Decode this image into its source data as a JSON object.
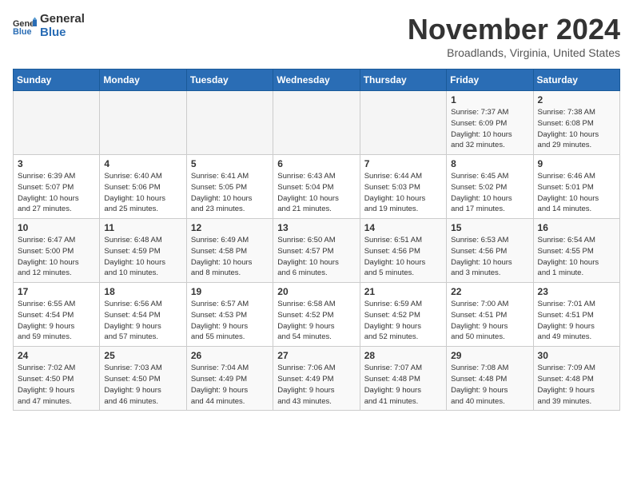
{
  "header": {
    "logo_general": "General",
    "logo_blue": "Blue",
    "month": "November 2024",
    "location": "Broadlands, Virginia, United States"
  },
  "days_of_week": [
    "Sunday",
    "Monday",
    "Tuesday",
    "Wednesday",
    "Thursday",
    "Friday",
    "Saturday"
  ],
  "weeks": [
    [
      {
        "day": "",
        "info": ""
      },
      {
        "day": "",
        "info": ""
      },
      {
        "day": "",
        "info": ""
      },
      {
        "day": "",
        "info": ""
      },
      {
        "day": "",
        "info": ""
      },
      {
        "day": "1",
        "info": "Sunrise: 7:37 AM\nSunset: 6:09 PM\nDaylight: 10 hours\nand 32 minutes."
      },
      {
        "day": "2",
        "info": "Sunrise: 7:38 AM\nSunset: 6:08 PM\nDaylight: 10 hours\nand 29 minutes."
      }
    ],
    [
      {
        "day": "3",
        "info": "Sunrise: 6:39 AM\nSunset: 5:07 PM\nDaylight: 10 hours\nand 27 minutes."
      },
      {
        "day": "4",
        "info": "Sunrise: 6:40 AM\nSunset: 5:06 PM\nDaylight: 10 hours\nand 25 minutes."
      },
      {
        "day": "5",
        "info": "Sunrise: 6:41 AM\nSunset: 5:05 PM\nDaylight: 10 hours\nand 23 minutes."
      },
      {
        "day": "6",
        "info": "Sunrise: 6:43 AM\nSunset: 5:04 PM\nDaylight: 10 hours\nand 21 minutes."
      },
      {
        "day": "7",
        "info": "Sunrise: 6:44 AM\nSunset: 5:03 PM\nDaylight: 10 hours\nand 19 minutes."
      },
      {
        "day": "8",
        "info": "Sunrise: 6:45 AM\nSunset: 5:02 PM\nDaylight: 10 hours\nand 17 minutes."
      },
      {
        "day": "9",
        "info": "Sunrise: 6:46 AM\nSunset: 5:01 PM\nDaylight: 10 hours\nand 14 minutes."
      }
    ],
    [
      {
        "day": "10",
        "info": "Sunrise: 6:47 AM\nSunset: 5:00 PM\nDaylight: 10 hours\nand 12 minutes."
      },
      {
        "day": "11",
        "info": "Sunrise: 6:48 AM\nSunset: 4:59 PM\nDaylight: 10 hours\nand 10 minutes."
      },
      {
        "day": "12",
        "info": "Sunrise: 6:49 AM\nSunset: 4:58 PM\nDaylight: 10 hours\nand 8 minutes."
      },
      {
        "day": "13",
        "info": "Sunrise: 6:50 AM\nSunset: 4:57 PM\nDaylight: 10 hours\nand 6 minutes."
      },
      {
        "day": "14",
        "info": "Sunrise: 6:51 AM\nSunset: 4:56 PM\nDaylight: 10 hours\nand 5 minutes."
      },
      {
        "day": "15",
        "info": "Sunrise: 6:53 AM\nSunset: 4:56 PM\nDaylight: 10 hours\nand 3 minutes."
      },
      {
        "day": "16",
        "info": "Sunrise: 6:54 AM\nSunset: 4:55 PM\nDaylight: 10 hours\nand 1 minute."
      }
    ],
    [
      {
        "day": "17",
        "info": "Sunrise: 6:55 AM\nSunset: 4:54 PM\nDaylight: 9 hours\nand 59 minutes."
      },
      {
        "day": "18",
        "info": "Sunrise: 6:56 AM\nSunset: 4:54 PM\nDaylight: 9 hours\nand 57 minutes."
      },
      {
        "day": "19",
        "info": "Sunrise: 6:57 AM\nSunset: 4:53 PM\nDaylight: 9 hours\nand 55 minutes."
      },
      {
        "day": "20",
        "info": "Sunrise: 6:58 AM\nSunset: 4:52 PM\nDaylight: 9 hours\nand 54 minutes."
      },
      {
        "day": "21",
        "info": "Sunrise: 6:59 AM\nSunset: 4:52 PM\nDaylight: 9 hours\nand 52 minutes."
      },
      {
        "day": "22",
        "info": "Sunrise: 7:00 AM\nSunset: 4:51 PM\nDaylight: 9 hours\nand 50 minutes."
      },
      {
        "day": "23",
        "info": "Sunrise: 7:01 AM\nSunset: 4:51 PM\nDaylight: 9 hours\nand 49 minutes."
      }
    ],
    [
      {
        "day": "24",
        "info": "Sunrise: 7:02 AM\nSunset: 4:50 PM\nDaylight: 9 hours\nand 47 minutes."
      },
      {
        "day": "25",
        "info": "Sunrise: 7:03 AM\nSunset: 4:50 PM\nDaylight: 9 hours\nand 46 minutes."
      },
      {
        "day": "26",
        "info": "Sunrise: 7:04 AM\nSunset: 4:49 PM\nDaylight: 9 hours\nand 44 minutes."
      },
      {
        "day": "27",
        "info": "Sunrise: 7:06 AM\nSunset: 4:49 PM\nDaylight: 9 hours\nand 43 minutes."
      },
      {
        "day": "28",
        "info": "Sunrise: 7:07 AM\nSunset: 4:48 PM\nDaylight: 9 hours\nand 41 minutes."
      },
      {
        "day": "29",
        "info": "Sunrise: 7:08 AM\nSunset: 4:48 PM\nDaylight: 9 hours\nand 40 minutes."
      },
      {
        "day": "30",
        "info": "Sunrise: 7:09 AM\nSunset: 4:48 PM\nDaylight: 9 hours\nand 39 minutes."
      }
    ]
  ]
}
